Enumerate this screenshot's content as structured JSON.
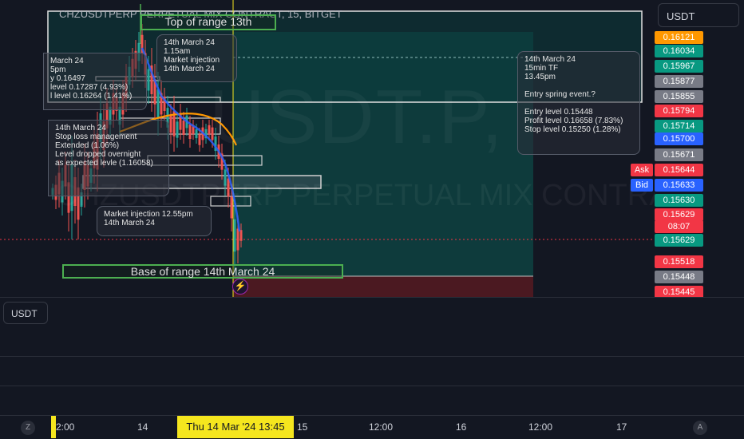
{
  "symbol": {
    "title": "CHZUSDTPERP PERPETUAL MIX CONTRACT, 15, BITGET",
    "watermark": "USDT.P,",
    "watermark_sub": "CHZUSDTPERP PERPETUAL MIX CONTRACT"
  },
  "currency": {
    "top_label": "USDT",
    "pane_label": "USDT"
  },
  "annotations": {
    "top_range": "Top of range 13th",
    "base_range": "Base of range 14th March 24",
    "note_injection_1": "14th March 24\n1.15am\nMarket injection\n14th March 24",
    "note_left_partial": "March 24\n5pm\ny 0.16497\nlevel 0.17287 (4.93%)\nl level 0.16264 (1.41%)",
    "note_stop_loss": "14th March 24\nStop loss management\nExtended (1.06%)\nLevel dropped overnight\nas expected levle (1.16058)",
    "note_injection_2": "Market injection 12.55pm\n14th March 24",
    "note_entry": "14th March 24\n15min TF\n13.45pm\n\nEntry spring event.?\n\nEntry level 0.15448\nProfit level 0.16658 (7.83%)\nStop level 0.15250 (1.28%)"
  },
  "price_axis": {
    "labels": [
      {
        "text": "0.16121",
        "color": "#ff9800"
      },
      {
        "text": "0.16034",
        "color": "#089981"
      },
      {
        "text": "0.15967",
        "color": "#089981"
      },
      {
        "text": "0.15877",
        "color": "#787b86"
      },
      {
        "text": "0.15855",
        "color": "#787b86"
      },
      {
        "text": "0.15794",
        "color": "#f23645"
      },
      {
        "text": "0.15714",
        "color": "#089981"
      },
      {
        "text": "0.15700",
        "color": "#2962ff"
      },
      {
        "text": "0.15671",
        "color": "#787b86"
      },
      {
        "text": "0.15644",
        "color": "#f23645"
      },
      {
        "text": "0.15633",
        "color": "#2962ff"
      },
      {
        "text": "0.15630",
        "color": "#089981"
      },
      {
        "text": "0.15629",
        "color": "#f23645"
      },
      {
        "text": "08:07",
        "color": "#f23645"
      },
      {
        "text": "0.15629",
        "color": "#089981"
      },
      {
        "text": "0.15518",
        "color": "#f23645"
      },
      {
        "text": "0.15448",
        "color": "#787b86"
      },
      {
        "text": "0.15445",
        "color": "#f23645"
      }
    ],
    "ask_label": "Ask",
    "bid_label": "Bid"
  },
  "time_axis": {
    "ticks": [
      "2:00",
      "14",
      "15",
      "12:00",
      "16",
      "12:00",
      "17"
    ],
    "crosshair": "Thu 14 Mar '24   13:45",
    "left_icon": "Z",
    "right_icon": "A"
  },
  "colors": {
    "background": "#131722",
    "teal_zone": "#0c4f4c",
    "red_zone": "#5a1a22",
    "range_green": "#4caf50",
    "crosshair": "#f5e61e",
    "ma_line": "#ff9800",
    "fast_line": "#2962ff"
  },
  "icons": {
    "alert": "lightning-icon"
  }
}
